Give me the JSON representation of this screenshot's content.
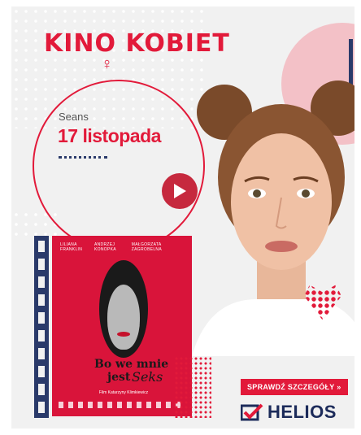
{
  "ad": {
    "title": "KINO KOBIET",
    "seans_label": "Seans",
    "seans_date": "17 listopada",
    "cta_label": "SPRAWDŹ SZCZEGÓŁY »",
    "brand": "HELIOS",
    "poster": {
      "credits": [
        "LILIANA FRANKLIN",
        "ANDRZEJ KONOPKA",
        "MAŁGORZATA ZAGROBELNA"
      ],
      "title_line1": "Bo we mnie",
      "title_line2": "jest",
      "title_script": "Seks",
      "subtitle": "Film Katarzyny Klimkiewicz"
    }
  },
  "colors": {
    "accent": "#e21a3a",
    "navy": "#1c2b5a",
    "pink": "#f3c1c7"
  },
  "icons": {
    "play": "play-icon",
    "venus": "venus-icon",
    "helios_logo": "helios-check-icon"
  }
}
